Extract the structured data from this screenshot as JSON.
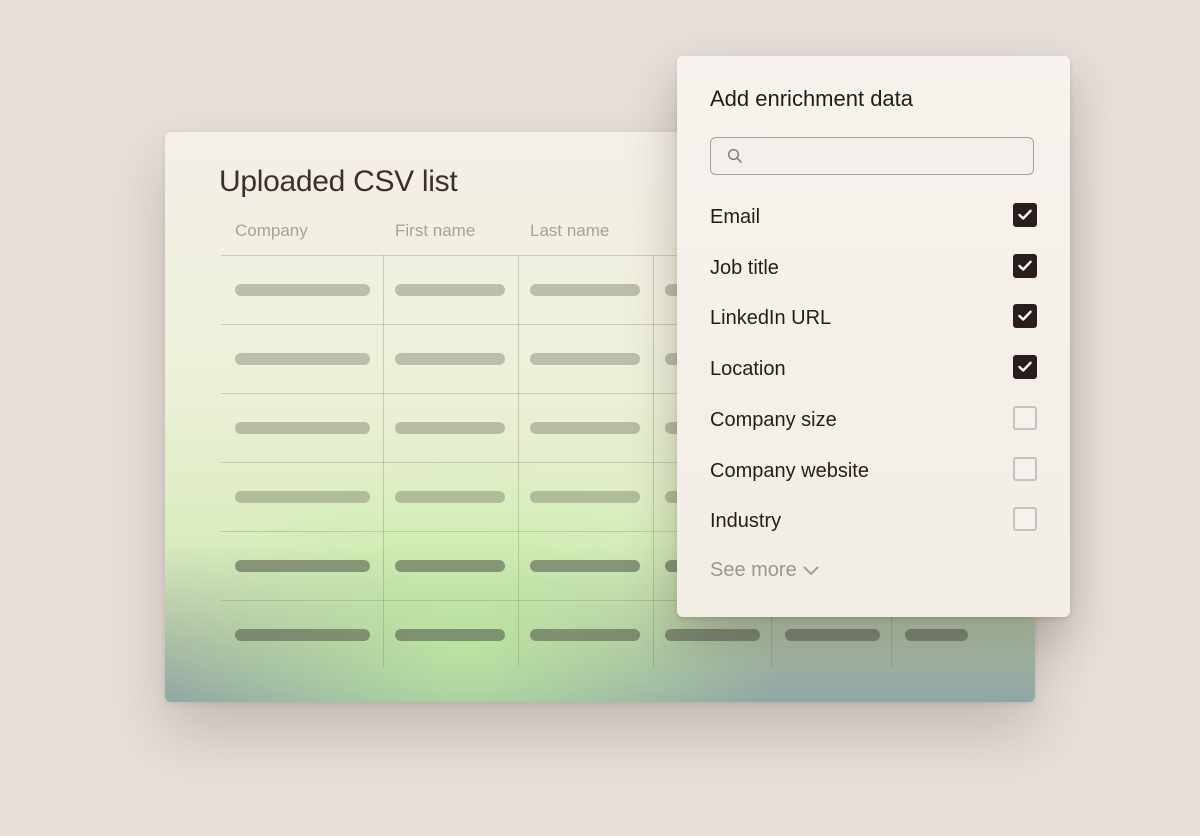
{
  "csv": {
    "title": "Uploaded CSV list",
    "columns": [
      "Company",
      "First name",
      "Last name"
    ]
  },
  "enrichment": {
    "title": "Add enrichment data",
    "search": {
      "placeholder": "",
      "icon": "search-icon"
    },
    "options": [
      {
        "label": "Email",
        "checked": true
      },
      {
        "label": "Job title",
        "checked": true
      },
      {
        "label": "LinkedIn URL",
        "checked": true
      },
      {
        "label": "Location",
        "checked": true
      },
      {
        "label": "Company size",
        "checked": false
      },
      {
        "label": "Company website",
        "checked": false
      },
      {
        "label": "Industry",
        "checked": false
      }
    ],
    "see_more": "See more"
  },
  "colors": {
    "background": "#e7dfda",
    "checkbox_checked": "#2b1d1b",
    "text_primary": "#241a18",
    "text_muted": "#9d968e"
  }
}
